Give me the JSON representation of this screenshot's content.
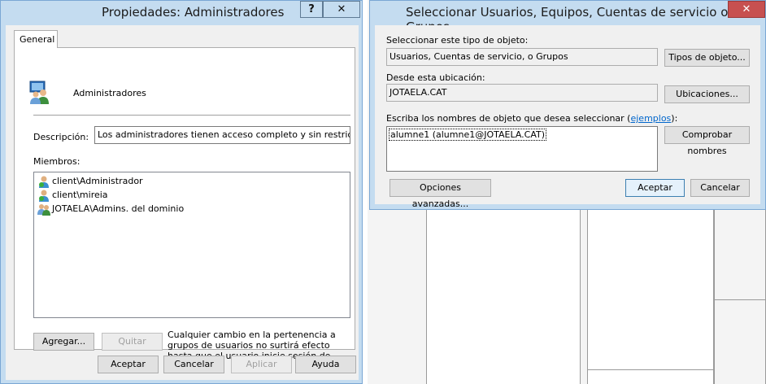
{
  "props_window": {
    "title": "Propiedades: Administradores",
    "help_button": "?",
    "close_button": "✕",
    "tab_general": "General",
    "group_name": "Administradores",
    "description_label": "Descripción:",
    "description_value": "Los administradores tienen acceso completo y sin restricciones al",
    "members_label": "Miembros:",
    "members": [
      {
        "name": "client\\Administrador",
        "icon": "user-icon"
      },
      {
        "name": "client\\mireia",
        "icon": "user-icon"
      },
      {
        "name": "JOTAELA\\Admins. del dominio",
        "icon": "group-icon"
      }
    ],
    "add_button": "Agregar...",
    "remove_button": "Quitar",
    "note": "Cualquier cambio en la pertenencia a grupos de usuarios no surtirá efecto hasta que el usuario inicie sesión de nuevo.",
    "ok_button": "Aceptar",
    "cancel_button": "Cancelar",
    "apply_button": "Aplicar",
    "help_footer_button": "Ayuda"
  },
  "select_window": {
    "title": "Seleccionar Usuarios, Equipos, Cuentas de servicio o Grupos",
    "close_button": "✕",
    "object_type_label": "Seleccionar este tipo de objeto:",
    "object_type_value": "Usuarios, Cuentas de servicio, o Grupos",
    "object_types_button": "Tipos de objeto...",
    "location_label": "Desde esta ubicación:",
    "location_value": "JOTAELA.CAT",
    "locations_button": "Ubicaciones...",
    "names_label": "Escriba los nombres de objeto que desea seleccionar (",
    "names_label_link": "ejemplos",
    "names_label_end": "):",
    "names_value": "alumne1 (alumne1@JOTAELA.CAT)",
    "check_names_button": "Comprobar nombres",
    "advanced_button": "Opciones avanzadas...",
    "ok_button": "Aceptar",
    "cancel_button": "Cancelar"
  },
  "colors": {
    "frame": "#c4dcf0",
    "close_red": "#c75050",
    "link": "#0066cc"
  }
}
